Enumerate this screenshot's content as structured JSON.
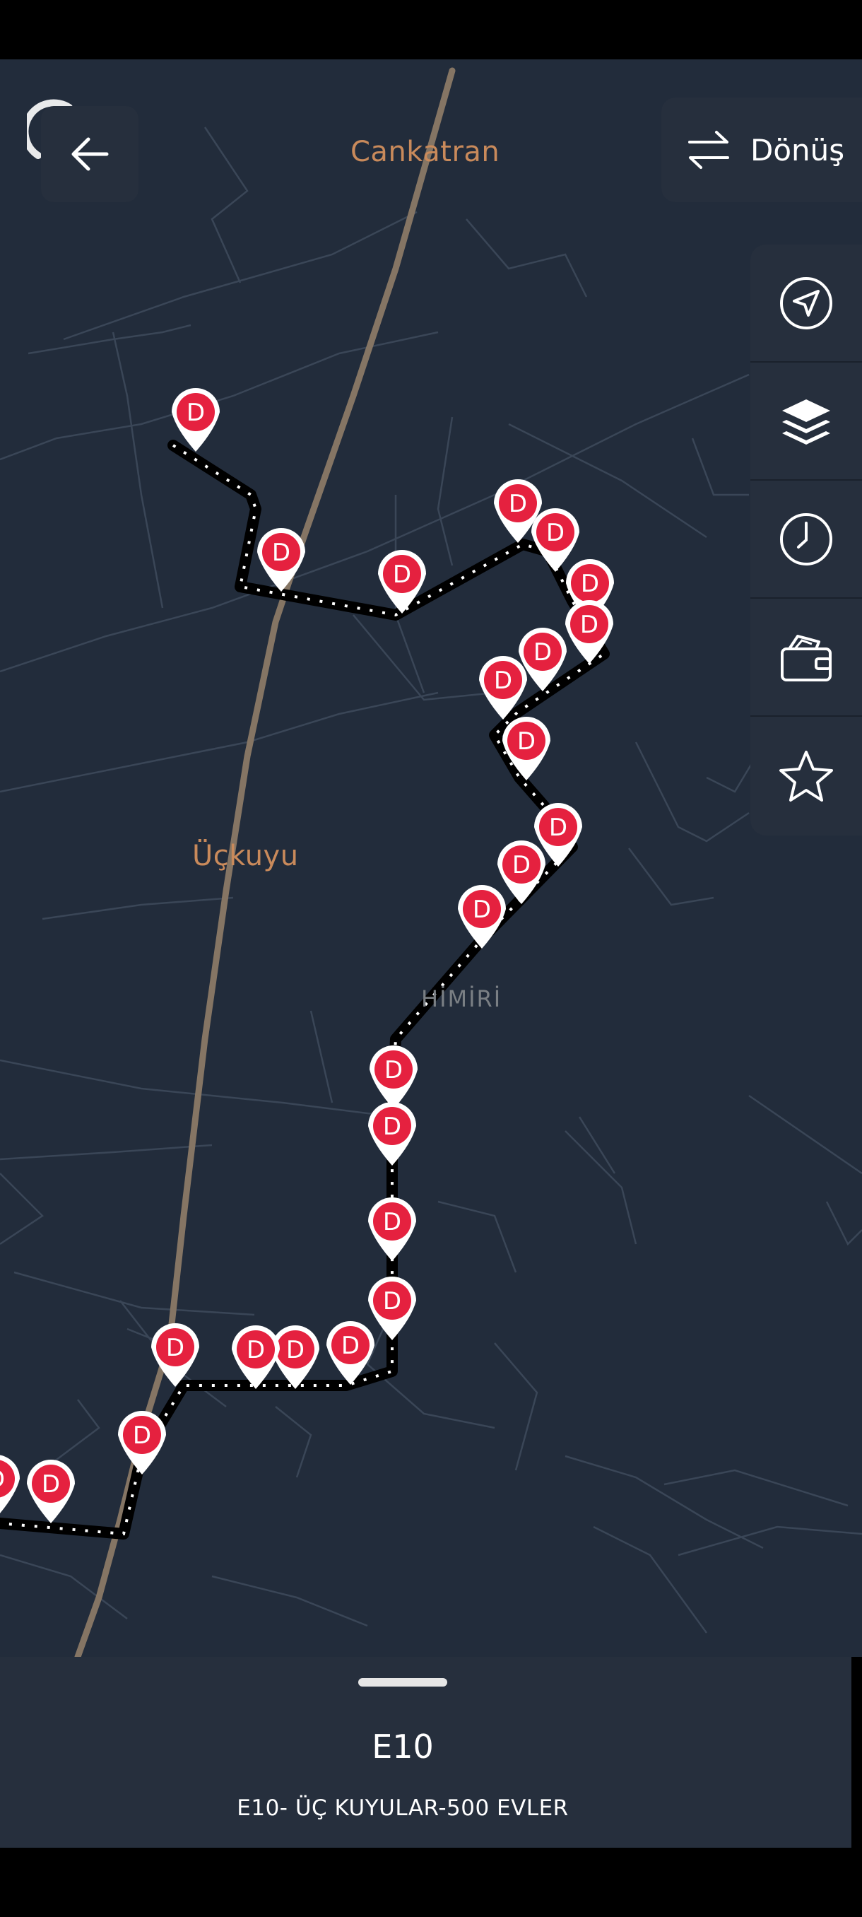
{
  "map": {
    "labels": {
      "town_north": "Cankatran",
      "town_center": "Üçkuyu",
      "district": "HİMİRİ"
    },
    "stop_marker_letter": "D",
    "stop_count": 27,
    "colors": {
      "background": "#222c3b",
      "road": "#3b4758",
      "highway": "#8a7a66",
      "route": "#000000",
      "stop_marker": "#e5213f",
      "label": "#c98a5b"
    }
  },
  "header": {
    "back_icon": "arrow-left-icon",
    "direction_label": "Dönüş",
    "direction_icon": "swap-arrows-icon"
  },
  "side_panel": {
    "buttons": [
      "navigate-icon",
      "layers-icon",
      "clock-icon",
      "wallet-icon",
      "star-icon"
    ]
  },
  "bottom_sheet": {
    "route_code": "E10",
    "route_name": "E10- ÜÇ KUYULAR-500 EVLER"
  }
}
